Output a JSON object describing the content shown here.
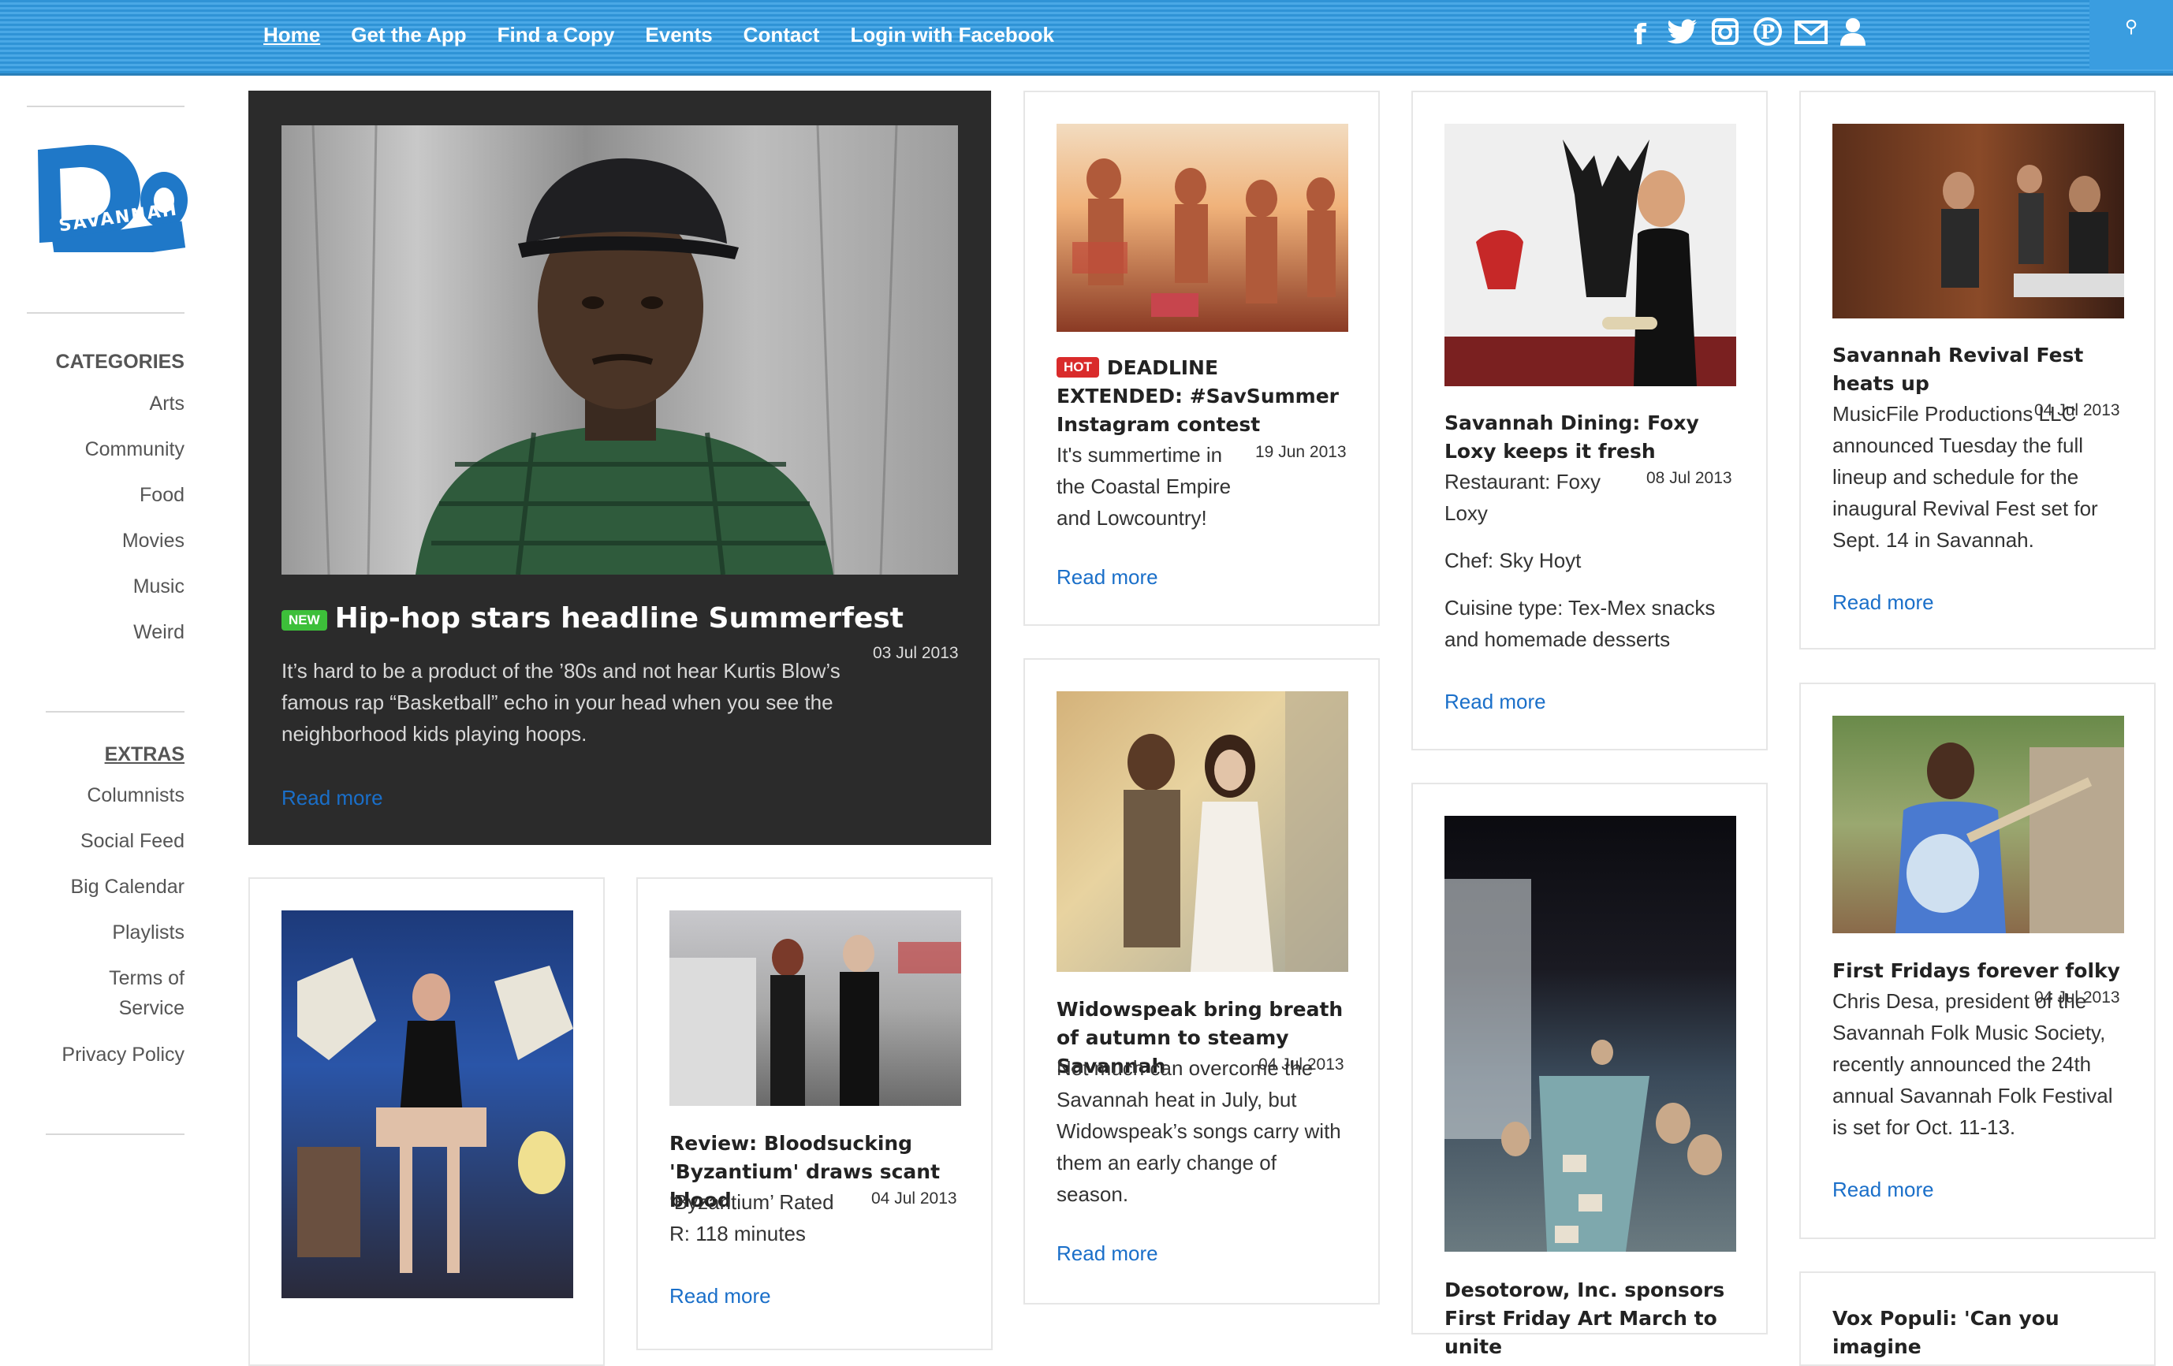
{
  "nav": {
    "items": [
      "Home",
      "Get the App",
      "Find a Copy",
      "Events",
      "Contact",
      "Login with Facebook"
    ],
    "active": "Home",
    "social_icons": [
      "facebook-icon",
      "twitter-icon",
      "instagram-icon",
      "pinterest-icon",
      "email-icon",
      "user-icon"
    ],
    "search_icon": "search-icon"
  },
  "logo": {
    "text": "Do",
    "subtext": "SAVANNAH"
  },
  "sidebar": {
    "categories_heading": "CATEGORIES",
    "categories": [
      "Arts",
      "Community",
      "Food",
      "Movies",
      "Music",
      "Weird"
    ],
    "extras_heading": "EXTRAS",
    "extras": [
      "Columnists",
      "Social Feed",
      "Big Calendar",
      "Playlists",
      "Terms of Service",
      "Privacy Policy"
    ]
  },
  "read_more_label": "Read more",
  "featured": {
    "badge": "NEW",
    "title": "Hip-hop stars headline Summerfest",
    "body": "It’s hard to be a product of the ’80s and not hear Kurtis Blow’s famous rap “Basketball” echo in your head when you see the neighborhood kids playing hoops.",
    "date": "03 Jul 2013"
  },
  "cards": [
    {
      "badge": "HOT",
      "title": "DEADLINE EXTENDED: #SavSummer Instagram contest",
      "body": "It's summertime in the Coastal Empire and Lowcountry!",
      "date": "19 Jun 2013"
    },
    {
      "title": "Savannah Dining: Foxy Loxy keeps it fresh",
      "body": "Restaurant: Foxy Loxy",
      "body2": "Chef: Sky Hoyt",
      "body3": "Cuisine type: Tex-Mex snacks and homemade desserts",
      "date": "08 Jul 2013"
    },
    {
      "title": "Savannah Revival Fest heats up",
      "body": "MusicFile Productions LLC announced Tuesday the full lineup and schedule for the inaugural Revival Fest set for Sept. 14 in Savannah.",
      "date": "04 Jul 2013"
    },
    {
      "title": "Widowspeak bring breath of autumn to steamy Savannah",
      "body": "Not much can overcome the Savannah heat in July, but Widowspeak’s songs carry with them an early change of season.",
      "date": "04 Jul 2013"
    },
    {
      "title": "First Fridays forever folky",
      "body": "Chris Desa, president of the Savannah Folk Music Society, recently announced the 24th annual Savannah Folk Festival is set for Oct. 11-13.",
      "date": "04 Jul 2013"
    },
    {
      "title": "Review: Bloodsucking 'Byzantium' draws scant blood",
      "body": "‘Byzantium’ Rated R: 118 minutes",
      "date": "04 Jul 2013"
    },
    {
      "title": "Desotorow, Inc. sponsors First Friday Art March to unite"
    },
    {
      "title": "Vox Populi: 'Can you imagine"
    }
  ],
  "colors": {
    "nav_blue": "#3a9de0",
    "logo_blue": "#1f78c8",
    "link_blue": "#1a6fc9",
    "featured_bg": "#2b2b2b",
    "badge_new": "#3dbf3a",
    "badge_hot": "#d92b2b"
  }
}
